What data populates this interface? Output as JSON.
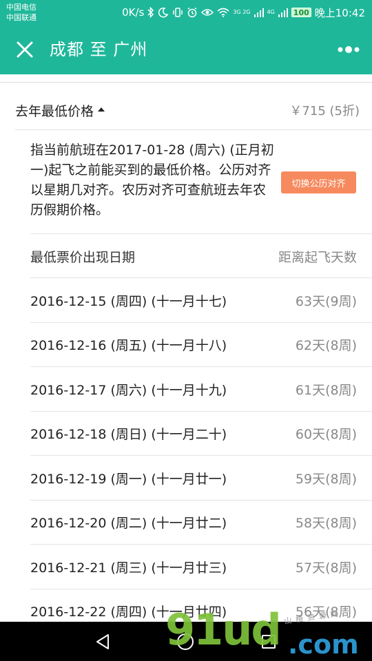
{
  "status_bar": {
    "carrier1": "中国电信",
    "carrier2": "中国联通",
    "speed": "0K/s",
    "net1": "3G 2G",
    "net2": "4G",
    "battery": "100",
    "time": "晚上10:42"
  },
  "app_bar": {
    "title": "成都 至 广州"
  },
  "section": {
    "title": "去年最低价格",
    "price": "￥715 (5折)"
  },
  "description": {
    "text": "指当前航班在2017-01-28 (周六) (正月初一)起飞之前能买到的最低价格。公历对齐以星期几对齐。农历对齐可查航班去年农历假期价格。",
    "switch_label": "切换公历对齐"
  },
  "list": {
    "header_left": "最低票价出现日期",
    "header_right": "距离起飞天数",
    "rows": [
      {
        "date": "2016-12-15 (周四) (十一月十七)",
        "days": "63天(9周)"
      },
      {
        "date": "2016-12-16 (周五) (十一月十八)",
        "days": "62天(8周)"
      },
      {
        "date": "2016-12-17 (周六) (十一月十九)",
        "days": "61天(8周)"
      },
      {
        "date": "2016-12-18 (周日) (十一月二十)",
        "days": "60天(8周)"
      },
      {
        "date": "2016-12-19 (周一) (十一月廿一)",
        "days": "59天(8周)"
      },
      {
        "date": "2016-12-20 (周二) (十一月廿二)",
        "days": "58天(8周)"
      },
      {
        "date": "2016-12-21 (周三) (十一月廿三)",
        "days": "57天(8周)"
      },
      {
        "date": "2016-12-22 (周四) (十一月廿四)",
        "days": "56天(8周)"
      }
    ]
  },
  "watermark": {
    "big": "91ud",
    "com": ".com",
    "small": "山楂资源网"
  },
  "colors": {
    "header_bg": "#1fb79a",
    "switch_btn": "#f68a5e",
    "secondary_text": "#888888"
  }
}
